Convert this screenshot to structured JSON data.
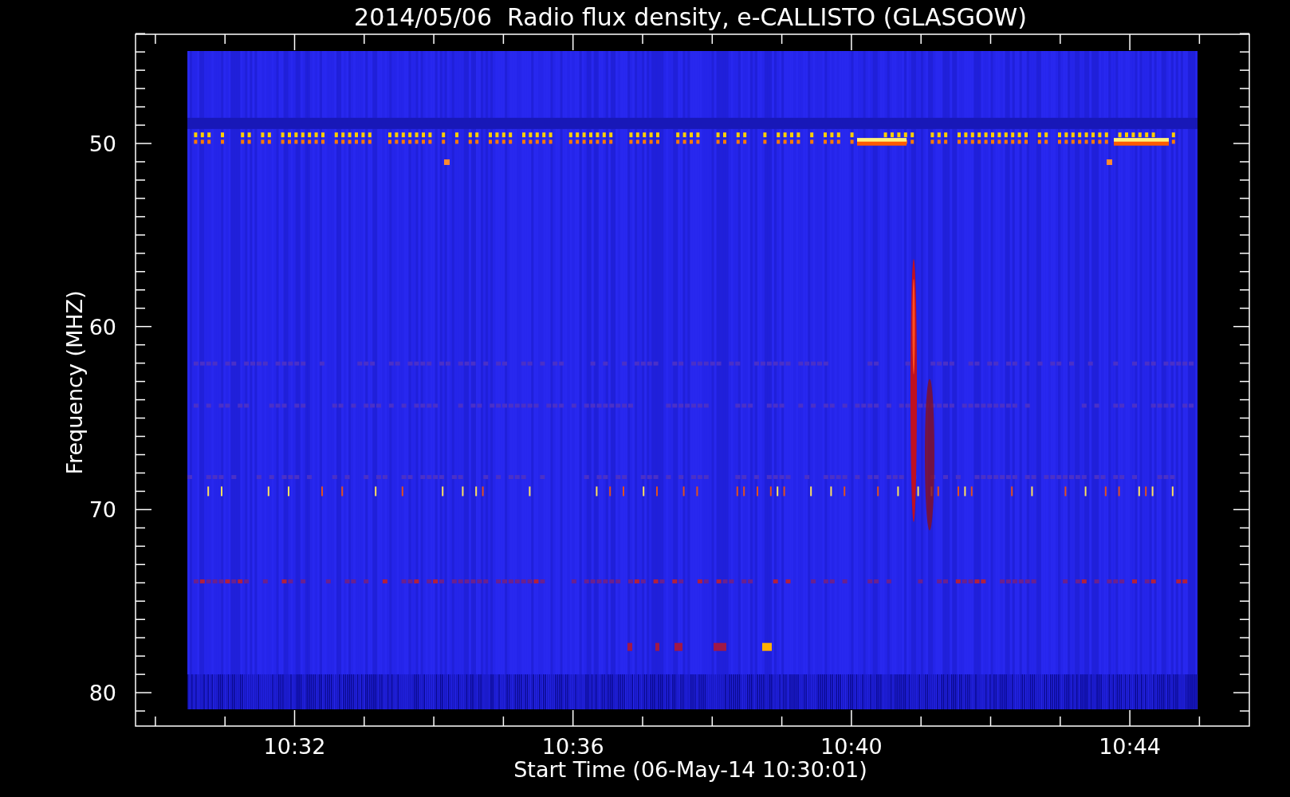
{
  "title": "2014/05/06  Radio flux density, e-CALLISTO (GLASGOW)",
  "y_axis": {
    "label": "Frequency (MHZ)",
    "tick_labels": [
      "50",
      "60",
      "70",
      "80"
    ]
  },
  "x_axis": {
    "label": "Start Time (06-May-14 10:30:01)",
    "tick_labels": [
      "10:32",
      "10:36",
      "10:40",
      "10:44"
    ]
  }
}
